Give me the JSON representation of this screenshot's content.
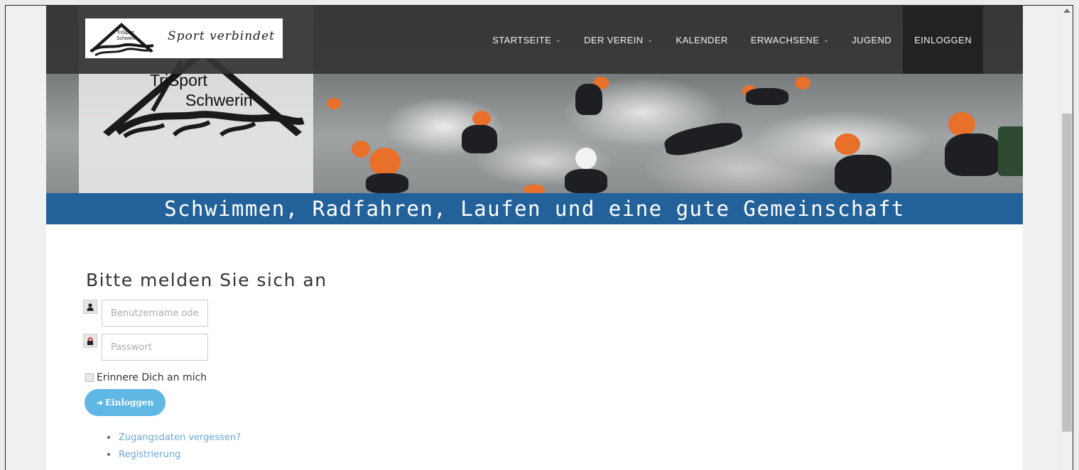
{
  "brand": {
    "slogan": "Sport verbindet",
    "logo_text_line1": "TriSport",
    "logo_text_line2": "Schwerin"
  },
  "nav": {
    "items": [
      {
        "label": "STARTSEITE",
        "dropdown": true
      },
      {
        "label": "DER VEREIN",
        "dropdown": true
      },
      {
        "label": "KALENDER",
        "dropdown": false
      },
      {
        "label": "ERWACHSENE",
        "dropdown": true
      },
      {
        "label": "JUGEND",
        "dropdown": false
      },
      {
        "label": "EINLOGGEN",
        "dropdown": false,
        "active": true
      }
    ]
  },
  "banner": {
    "text": "Schwimmen, Radfahren, Laufen und eine gute Gemeinschaft"
  },
  "login": {
    "title": "Bitte melden Sie sich an",
    "username_placeholder": "Benutzername oder E-Mail",
    "username_icon": "user-icon",
    "password_placeholder": "Passwort",
    "password_icon": "lock-icon",
    "remember_label": "Erinnere Dich an mich",
    "submit_label": "Einloggen",
    "submit_icon": "sign-in-icon",
    "links": [
      "Zugangsdaten vergessen?",
      "Registrierung"
    ]
  },
  "colors": {
    "navbar": "#343434",
    "banner": "#23619a",
    "button": "#5fb7e4",
    "link": "#6aa9d8"
  }
}
